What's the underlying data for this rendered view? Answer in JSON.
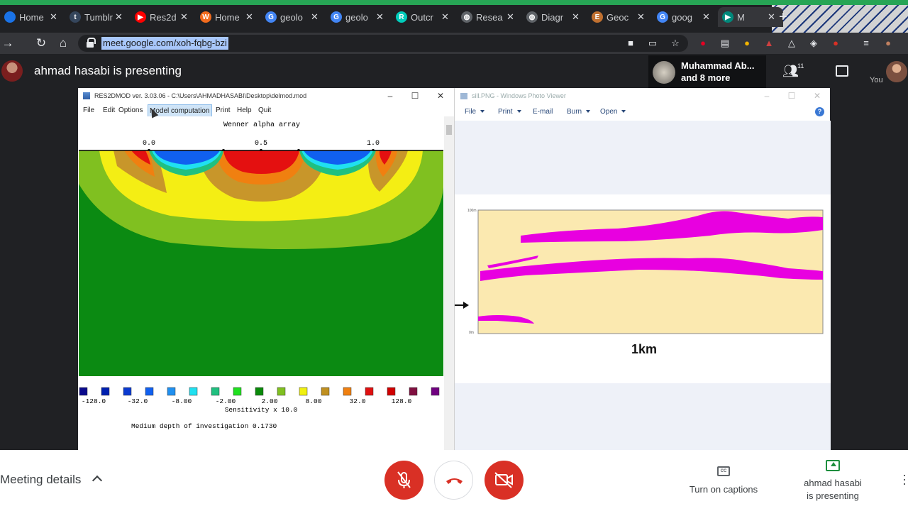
{
  "browser": {
    "tabs": [
      {
        "label": "Home",
        "favicon": "blue-globe-icon",
        "color": "#1a73e8",
        "glyph": ""
      },
      {
        "label": "Tumblr",
        "favicon": "tumblr-icon",
        "color": "#35465c",
        "glyph": "t"
      },
      {
        "label": "Res2d",
        "favicon": "youtube-icon",
        "color": "#ff0000",
        "glyph": "▶"
      },
      {
        "label": "Home",
        "favicon": "workplace-icon",
        "color": "#f26b1d",
        "glyph": "W"
      },
      {
        "label": "geolo",
        "favicon": "google-icon",
        "color": "#4285f4",
        "glyph": "G"
      },
      {
        "label": "geolo",
        "favicon": "google-icon",
        "color": "#4285f4",
        "glyph": "G"
      },
      {
        "label": "Outcr",
        "favicon": "researchgate-icon",
        "color": "#00ccbb",
        "glyph": "R"
      },
      {
        "label": "Resea",
        "favicon": "globe-icon",
        "color": "#5f6368",
        "glyph": "◍"
      },
      {
        "label": "Diagr",
        "favicon": "globe-icon",
        "color": "#5f6368",
        "glyph": "◍"
      },
      {
        "label": "Geoc",
        "favicon": "encyclopedia-icon",
        "color": "#c07030",
        "glyph": "E"
      },
      {
        "label": "goog",
        "favicon": "google-icon",
        "color": "#4285f4",
        "glyph": "G"
      },
      {
        "label": "M",
        "favicon": "meet-icon",
        "color": "#00897b",
        "glyph": "▶"
      }
    ],
    "url": "meet.google.com/xoh-fqbg-bzi"
  },
  "meet": {
    "presenter_text": "ahmad hasabi is presenting",
    "participants_line1": "Muhammad Ab...",
    "participants_line2": "and 8 more",
    "people_count": "11",
    "you_label": "You",
    "meeting_details": "Meeting details",
    "captions_label": "Turn on captions",
    "presenting_label_1": "ahmad hasabi",
    "presenting_label_2": "is presenting",
    "brand_red": "#d93025",
    "present_green": "#1e8e3e"
  },
  "res2dmod": {
    "title": "RES2DMOD ver. 3.03.06 - C:\\Users\\AHMADHASABI\\Desktop\\delmod.mod",
    "menu": [
      "File",
      "Edit",
      "Options",
      "Model computation",
      "Print",
      "Help",
      "Quit"
    ],
    "highlighted_menu": "Model computation",
    "chart_data": {
      "type": "heatmap",
      "title": "Wenner alpha array",
      "x_ticks": [
        "0.0",
        "0.5",
        "1.0"
      ],
      "legend_values": [
        "-128.0",
        "-32.0",
        "-8.00",
        "-2.00",
        "2.00",
        "8.00",
        "32.0",
        "128.0"
      ],
      "legend_colors": [
        "#0a0a8c",
        "#0020b0",
        "#0a3ad0",
        "#1060f0",
        "#2090f0",
        "#20e0f0",
        "#20c080",
        "#20e020",
        "#0a8a0a",
        "#80c020",
        "#f0f010",
        "#c09020",
        "#f08010",
        "#e01010",
        "#d00000",
        "#801040",
        "#700080"
      ],
      "legend_title": "Sensitivity x 10.0",
      "depth_text": "Medium depth of investigation 0.1730"
    }
  },
  "photoviewer": {
    "title": "sill.PNG - Windows Photo Viewer",
    "menu": [
      "File",
      "Print",
      "E-mail",
      "Burn",
      "Open"
    ],
    "scale_label": "1km",
    "axis_top": "100m",
    "axis_bottom": "0m",
    "sill_color": "#e800e0",
    "host_color": "#fbe9b0"
  }
}
